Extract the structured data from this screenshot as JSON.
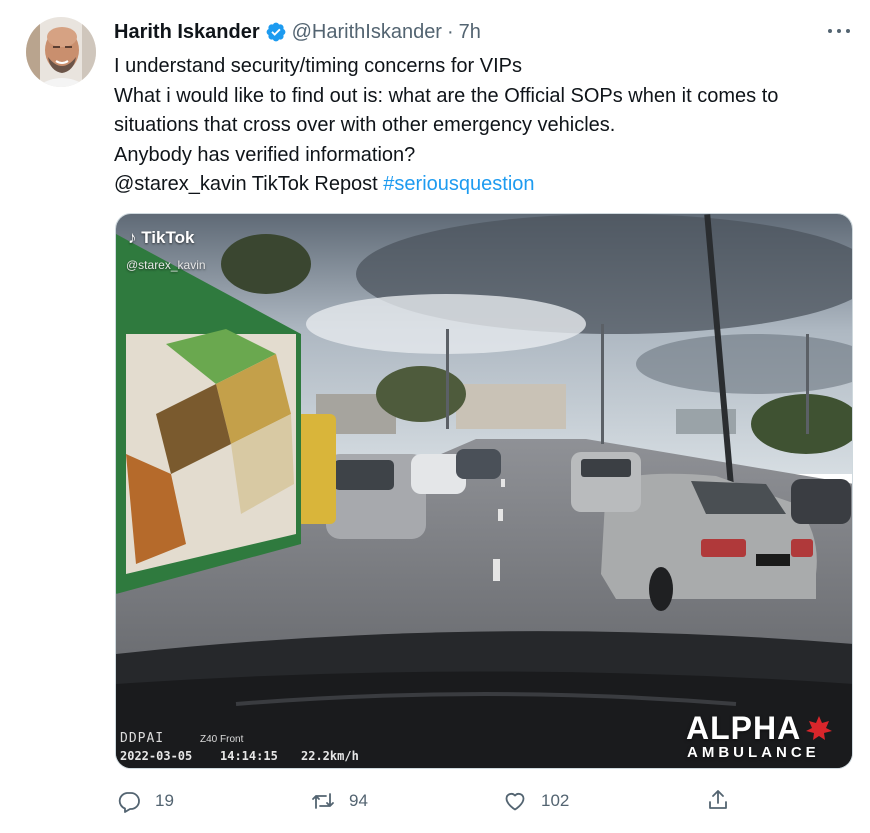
{
  "author": {
    "display_name": "Harith Iskander",
    "handle": "@HarithIskander",
    "separator": "·",
    "timestamp": "7h",
    "verified": true
  },
  "tweet": {
    "lines": [
      "I understand security/timing concerns for VIPs",
      "What i would like to find out is: what are the Official SOPs when it comes to",
      "situations that cross over with other emergency vehicles.",
      "Anybody has verified information?"
    ],
    "last_line_prefix": "@starex_kavin TikTok Repost ",
    "hashtag": "#seriousquestion"
  },
  "media": {
    "tiktok_logo": "TikTok",
    "tiktok_user": "@starex_kavin",
    "dashcam": {
      "brand": "DDPAI",
      "model": "Z40 Front",
      "date": "2022-03-05",
      "time": "14:14:15",
      "speed": "22.2km/h"
    },
    "watermark": {
      "line1": "ALPHA",
      "line2": "AMBULANCE"
    }
  },
  "actions": {
    "reply_count": "19",
    "retweet_count": "94",
    "like_count": "102"
  },
  "colors": {
    "accent": "#1d9bf0",
    "text_primary": "#0f1419",
    "text_secondary": "#536471",
    "watermark_accent": "#d9262b"
  },
  "icons": {
    "more": "more-horizontal-icon",
    "verified": "verified-badge-icon",
    "reply": "reply-icon",
    "retweet": "retweet-icon",
    "like": "heart-icon",
    "share": "share-icon"
  }
}
